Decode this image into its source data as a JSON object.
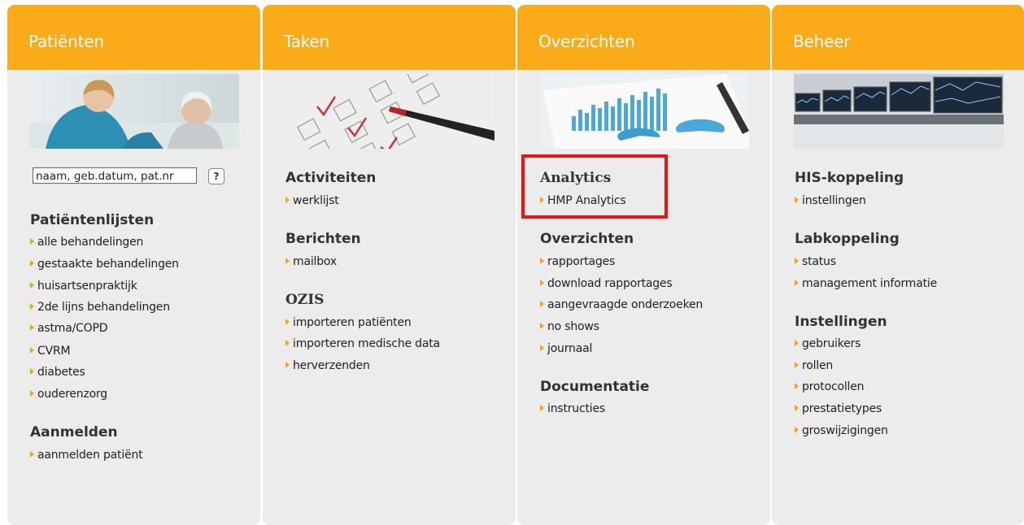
{
  "columns": [
    {
      "title": "Patiënten",
      "search_value": "naam, geb.datum, pat.nr",
      "help_label": "?",
      "sections": [
        {
          "title": "Patiëntenlijsten",
          "links": [
            "alle behandelingen",
            "gestaakte behandelingen",
            "huisartsenpraktijk",
            "2de lijns behandelingen",
            "astma/COPD",
            "CVRM",
            "diabetes",
            "ouderenzorg"
          ]
        },
        {
          "title": "Aanmelden",
          "links": [
            "aanmelden patiënt"
          ]
        }
      ]
    },
    {
      "title": "Taken",
      "sections": [
        {
          "title": "Activiteiten",
          "links": [
            "werklijst"
          ]
        },
        {
          "title": "Berichten",
          "links": [
            "mailbox"
          ]
        },
        {
          "title": "OZIS",
          "links": [
            "importeren patiënten",
            "importeren medische data",
            "herverzenden"
          ]
        }
      ]
    },
    {
      "title": "Overzichten",
      "sections": [
        {
          "title": "Analytics",
          "links": [
            "HMP Analytics"
          ]
        },
        {
          "title": "Overzichten",
          "links": [
            "rapportages",
            "download rapportages",
            "aangevraagde onderzoeken",
            "no shows",
            "journaal"
          ]
        },
        {
          "title": "Documentatie",
          "links": [
            "instructies"
          ]
        }
      ]
    },
    {
      "title": "Beheer",
      "sections": [
        {
          "title": "HIS-koppeling",
          "links": [
            "instellingen"
          ]
        },
        {
          "title": "Labkoppeling",
          "links": [
            "status",
            "management informatie"
          ]
        },
        {
          "title": "Instellingen",
          "links": [
            "gebruikers",
            "rollen",
            "protocollen",
            "prestatietypes",
            "groswijzigingen"
          ]
        }
      ]
    }
  ],
  "colors": {
    "header": "#fbab1a",
    "panel": "#ececec",
    "arrow": "#f7a21b",
    "highlight": "#e11111"
  }
}
